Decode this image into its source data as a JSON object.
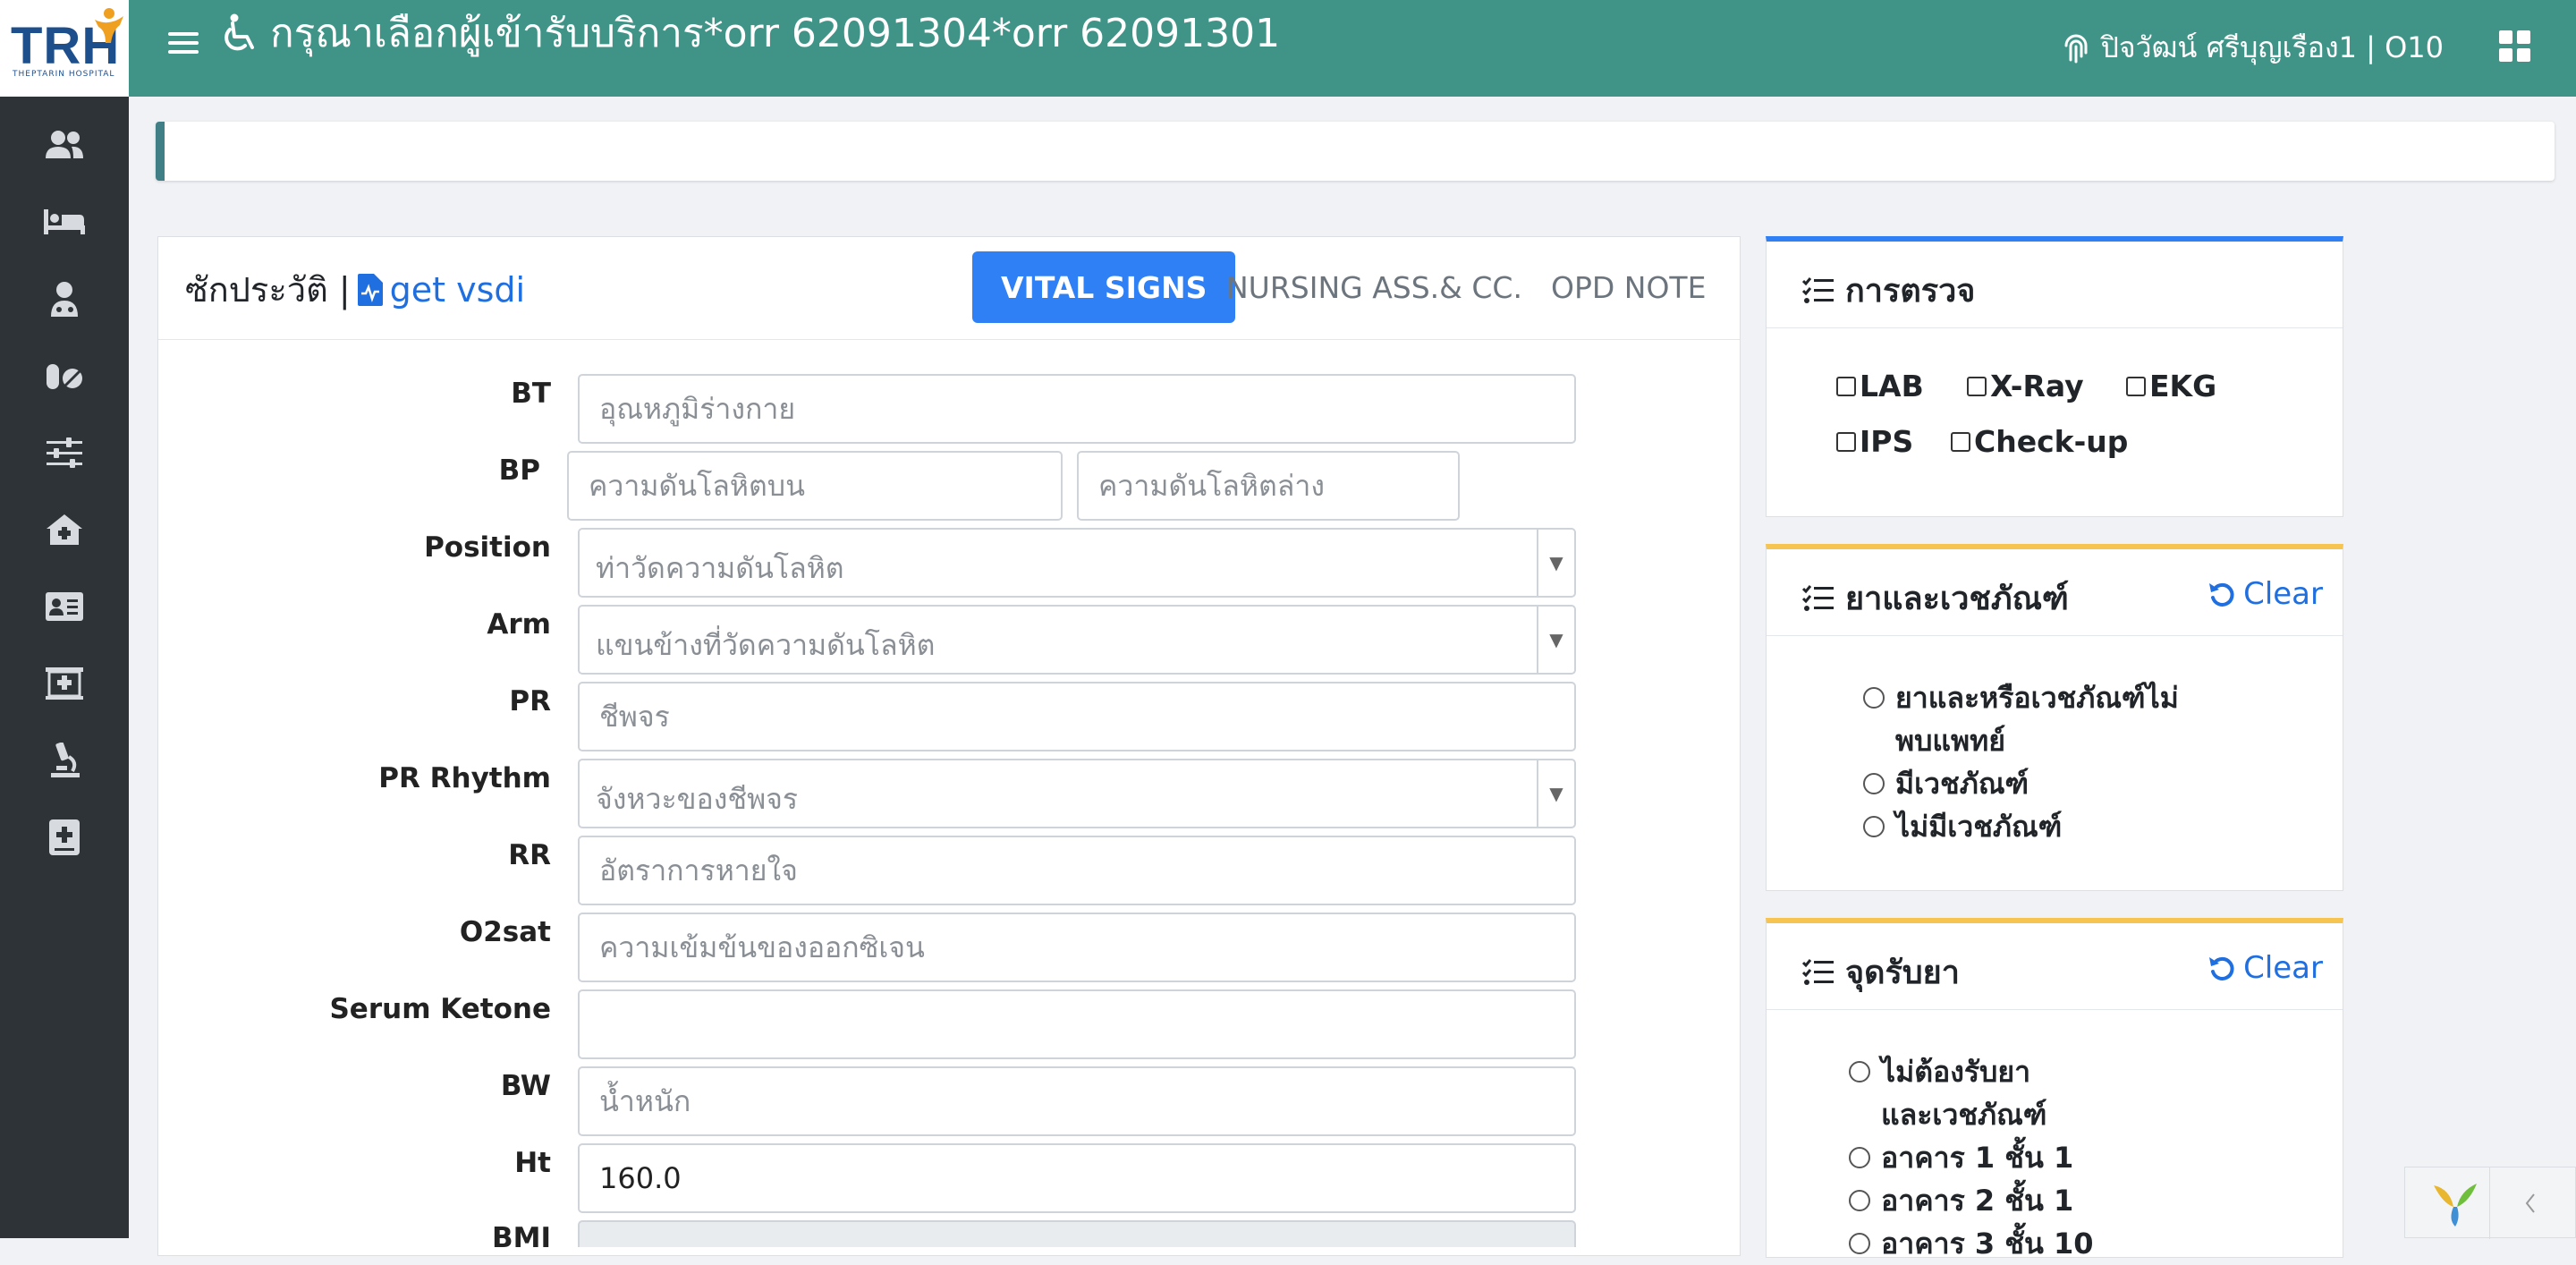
{
  "header": {
    "logo_text": "TRH",
    "logo_sub": "THEPTARIN HOSPITAL",
    "title": "กรุณาเลือกผู้เข้ารับบริการ*orr 62091304*orr 62091301",
    "user": "ปิจวัฒน์ ศรีบุญเรือง1 | O10"
  },
  "sidebar": {
    "icons": [
      "users-icon",
      "bed-icon",
      "doctor-icon",
      "pills-icon",
      "sliders-icon",
      "clinic-home-icon",
      "id-card-icon",
      "hospital-icon",
      "microscope-icon",
      "medical-book-icon"
    ]
  },
  "main": {
    "history_label": "ซักประวัติ |",
    "get_vs_label": "get vsdi",
    "tabs": [
      "VITAL SIGNS",
      "NURSING ASS.& CC.",
      "OPD NOTE"
    ],
    "fields": {
      "bt": {
        "label": "BT",
        "placeholder": "อุณหภูมิร่างกาย",
        "value": ""
      },
      "bp": {
        "label": "BP",
        "placeholder_sys": "ความดันโลหิตบน",
        "placeholder_dia": "ความดันโลหิตล่าง"
      },
      "position": {
        "label": "Position",
        "placeholder": "ท่าวัดความดันโลหิต"
      },
      "arm": {
        "label": "Arm",
        "placeholder": "แขนข้างที่วัดความดันโลหิต"
      },
      "pr": {
        "label": "PR",
        "placeholder": "ชีพจร",
        "value": ""
      },
      "pr_rhythm": {
        "label": "PR Rhythm",
        "placeholder": "จังหวะของชีพจร"
      },
      "rr": {
        "label": "RR",
        "placeholder": "อัตราการหายใจ",
        "value": ""
      },
      "o2sat": {
        "label": "O2sat",
        "placeholder": "ความเข้มข้นของออกซิเจน",
        "value": ""
      },
      "serum_ketone": {
        "label": "Serum Ketone",
        "placeholder": "",
        "value": ""
      },
      "bw": {
        "label": "BW",
        "placeholder": "น้ำหนัก",
        "value": ""
      },
      "ht": {
        "label": "Ht",
        "placeholder": "",
        "value": "160.0"
      },
      "bmi": {
        "label": "BMI"
      }
    }
  },
  "exam": {
    "title": "การตรวจ",
    "options": [
      "LAB",
      "X-Ray",
      "EKG",
      "IPS",
      "Check-up"
    ]
  },
  "supplies": {
    "title": "ยาและเวชภัณฑ์",
    "clear": "Clear",
    "options": [
      "ยาและหรือเวชภัณฑ์ไม่พบแพทย์",
      "มีเวชภัณฑ์",
      "ไม่มีเวชภัณฑ์"
    ]
  },
  "pickup": {
    "title": "จุดรับยา",
    "clear": "Clear",
    "options": [
      "ไม่ต้องรับยาและเวชภัณฑ์",
      "อาคาร 1 ชั้น 1",
      "อาคาร 2 ชั้น 1",
      "อาคาร 3 ชั้น 10"
    ]
  },
  "colors": {
    "topbar": "#3f9487",
    "sidebar": "#2e3337",
    "primary": "#2f80f5",
    "link": "#1f6fe0",
    "exam_accent": "#2f80f5",
    "supplies_accent": "#f5c451"
  }
}
